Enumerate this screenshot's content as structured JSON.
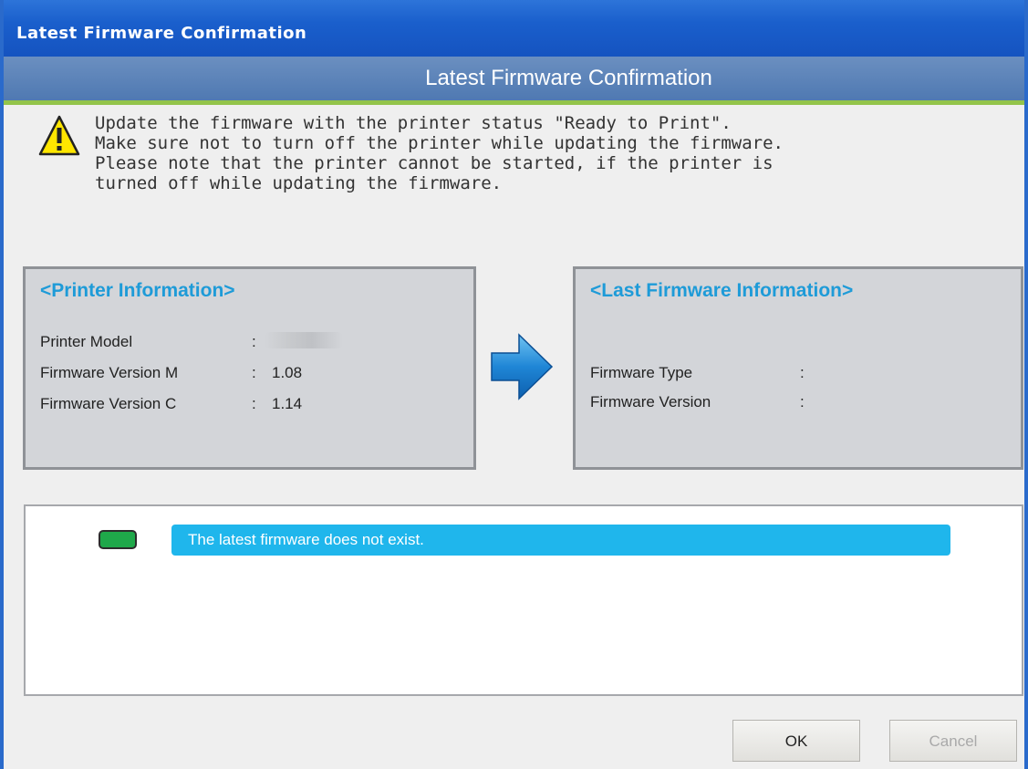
{
  "window": {
    "title": "Latest Firmware Confirmation"
  },
  "banner": {
    "title": "Latest Firmware Confirmation"
  },
  "warning": {
    "lines": [
      "Update the firmware with the printer status \"Ready to Print\".",
      "Make sure not to turn off the printer while updating the firmware.",
      "Please note that the printer cannot be started, if the printer is",
      "turned off while updating the firmware."
    ]
  },
  "printer_info": {
    "title": "<Printer Information>",
    "rows": [
      {
        "label": "Printer Model",
        "colon": ":",
        "value": ""
      },
      {
        "label": "Firmware Version M",
        "colon": ":",
        "value": "1.08"
      },
      {
        "label": "Firmware Version C",
        "colon": ":",
        "value": "1.14"
      }
    ]
  },
  "last_firmware": {
    "title": "<Last Firmware Information>",
    "rows": [
      {
        "label": "Firmware Type",
        "colon": ":",
        "value": ""
      },
      {
        "label": "Firmware Version",
        "colon": ":",
        "value": ""
      }
    ]
  },
  "status": {
    "message": "The latest firmware does not exist.",
    "indicator_color": "#1fa84a"
  },
  "buttons": {
    "ok": "OK",
    "cancel": "Cancel"
  },
  "colors": {
    "accent": "#1e9bd8",
    "titlebar": "#1a5fcc",
    "status_bar": "#1fb6ec",
    "banner_underline": "#93c44a"
  },
  "icons": {
    "warning": "warning-icon",
    "arrow": "arrow-right-icon"
  }
}
